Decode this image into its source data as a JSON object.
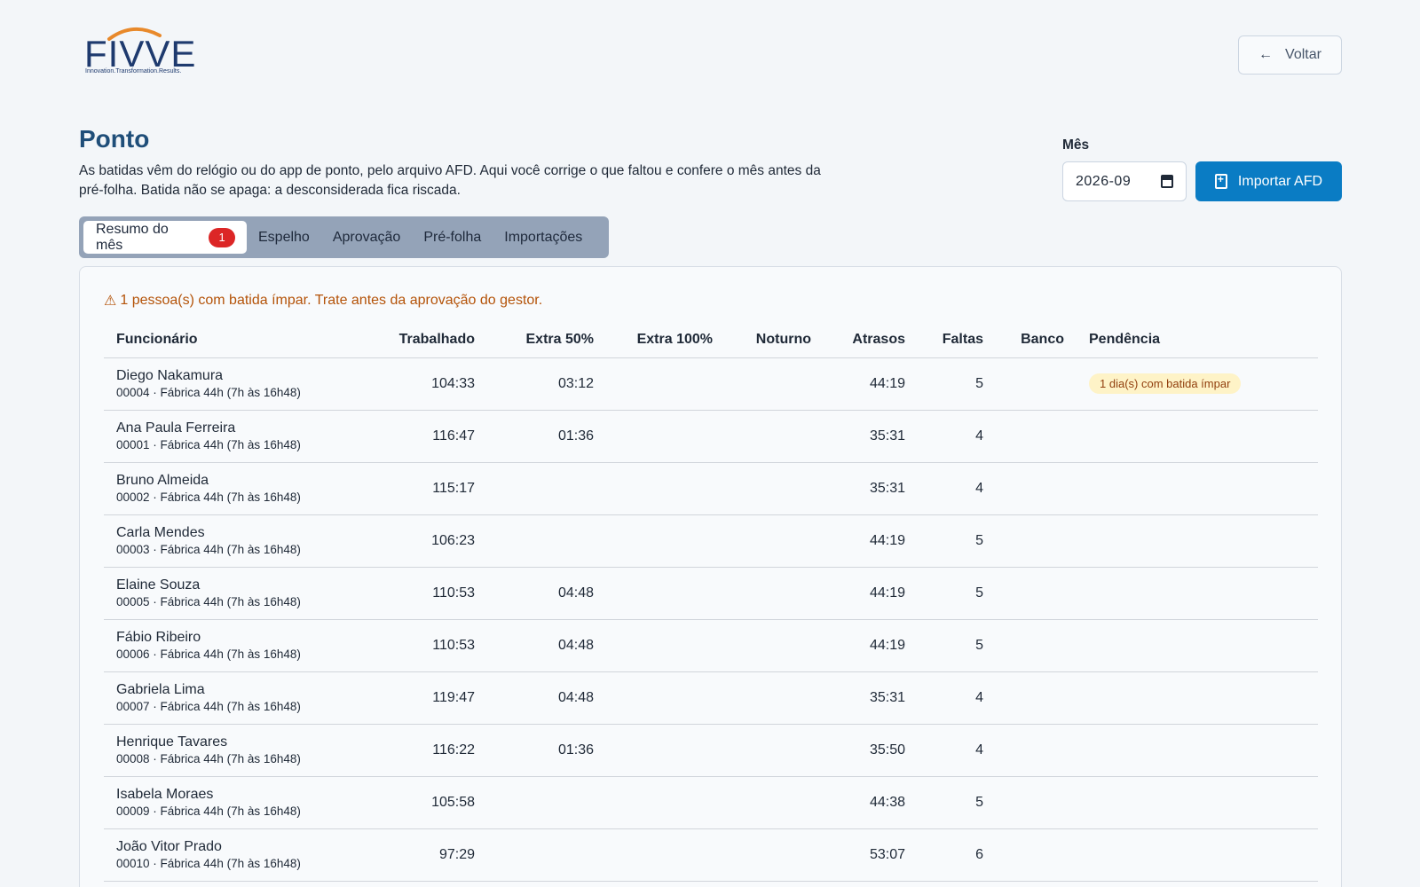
{
  "logo": {
    "brand": "FIVVE",
    "tagline": "Innovation.Transformation.Results."
  },
  "header": {
    "back_label": "Voltar"
  },
  "page": {
    "title": "Ponto",
    "description": "As batidas vêm do relógio ou do app de ponto, pelo arquivo AFD. Aqui você corrige o que faltou e confere o mês antes da pré-folha. Batida não se apaga: a desconsiderada fica riscada.",
    "month_label": "Mês",
    "month_value": "2026-09",
    "import_label": "Importar AFD"
  },
  "tabs": [
    {
      "label": "Resumo do mês",
      "badge": "1",
      "active": true
    },
    {
      "label": "Espelho"
    },
    {
      "label": "Aprovação"
    },
    {
      "label": "Pré-folha"
    },
    {
      "label": "Importações"
    }
  ],
  "alert": {
    "text": "1 pessoa(s) com batida ímpar. Trate antes da aprovação do gestor."
  },
  "table": {
    "headers": [
      "Funcionário",
      "Trabalhado",
      "Extra 50%",
      "Extra 100%",
      "Noturno",
      "Atrasos",
      "Faltas",
      "Banco",
      "Pendência"
    ],
    "rows": [
      {
        "name": "Diego Nakamura",
        "sub": "00004 · Fábrica 44h (7h às 16h48)",
        "trabalhado": "104:33",
        "extra50": "03:12",
        "extra100": "",
        "noturno": "",
        "atrasos": "44:19",
        "faltas": "5",
        "banco": "",
        "pendencia": "1 dia(s) com batida ímpar"
      },
      {
        "name": "Ana Paula Ferreira",
        "sub": "00001 · Fábrica 44h (7h às 16h48)",
        "trabalhado": "116:47",
        "extra50": "01:36",
        "extra100": "",
        "noturno": "",
        "atrasos": "35:31",
        "faltas": "4",
        "banco": "",
        "pendencia": ""
      },
      {
        "name": "Bruno Almeida",
        "sub": "00002 · Fábrica 44h (7h às 16h48)",
        "trabalhado": "115:17",
        "extra50": "",
        "extra100": "",
        "noturno": "",
        "atrasos": "35:31",
        "faltas": "4",
        "banco": "",
        "pendencia": ""
      },
      {
        "name": "Carla Mendes",
        "sub": "00003 · Fábrica 44h (7h às 16h48)",
        "trabalhado": "106:23",
        "extra50": "",
        "extra100": "",
        "noturno": "",
        "atrasos": "44:19",
        "faltas": "5",
        "banco": "",
        "pendencia": ""
      },
      {
        "name": "Elaine Souza",
        "sub": "00005 · Fábrica 44h (7h às 16h48)",
        "trabalhado": "110:53",
        "extra50": "04:48",
        "extra100": "",
        "noturno": "",
        "atrasos": "44:19",
        "faltas": "5",
        "banco": "",
        "pendencia": ""
      },
      {
        "name": "Fábio Ribeiro",
        "sub": "00006 · Fábrica 44h (7h às 16h48)",
        "trabalhado": "110:53",
        "extra50": "04:48",
        "extra100": "",
        "noturno": "",
        "atrasos": "44:19",
        "faltas": "5",
        "banco": "",
        "pendencia": ""
      },
      {
        "name": "Gabriela Lima",
        "sub": "00007 · Fábrica 44h (7h às 16h48)",
        "trabalhado": "119:47",
        "extra50": "04:48",
        "extra100": "",
        "noturno": "",
        "atrasos": "35:31",
        "faltas": "4",
        "banco": "",
        "pendencia": ""
      },
      {
        "name": "Henrique Tavares",
        "sub": "00008 · Fábrica 44h (7h às 16h48)",
        "trabalhado": "116:22",
        "extra50": "01:36",
        "extra100": "",
        "noturno": "",
        "atrasos": "35:50",
        "faltas": "4",
        "banco": "",
        "pendencia": ""
      },
      {
        "name": "Isabela Moraes",
        "sub": "00009 · Fábrica 44h (7h às 16h48)",
        "trabalhado": "105:58",
        "extra50": "",
        "extra100": "",
        "noturno": "",
        "atrasos": "44:38",
        "faltas": "5",
        "banco": "",
        "pendencia": ""
      },
      {
        "name": "João Vitor Prado",
        "sub": "00010 · Fábrica 44h (7h às 16h48)",
        "trabalhado": "97:29",
        "extra50": "",
        "extra100": "",
        "noturno": "",
        "atrasos": "53:07",
        "faltas": "6",
        "banco": "",
        "pendencia": ""
      }
    ]
  },
  "colors": {
    "title": "#1f4e79",
    "primary_button": "#0a7cc4",
    "alert_text": "#b45309",
    "tab_bar": "#94a3b8",
    "badge_red": "#dc2626",
    "pending_badge_bg": "#fef3c7"
  }
}
